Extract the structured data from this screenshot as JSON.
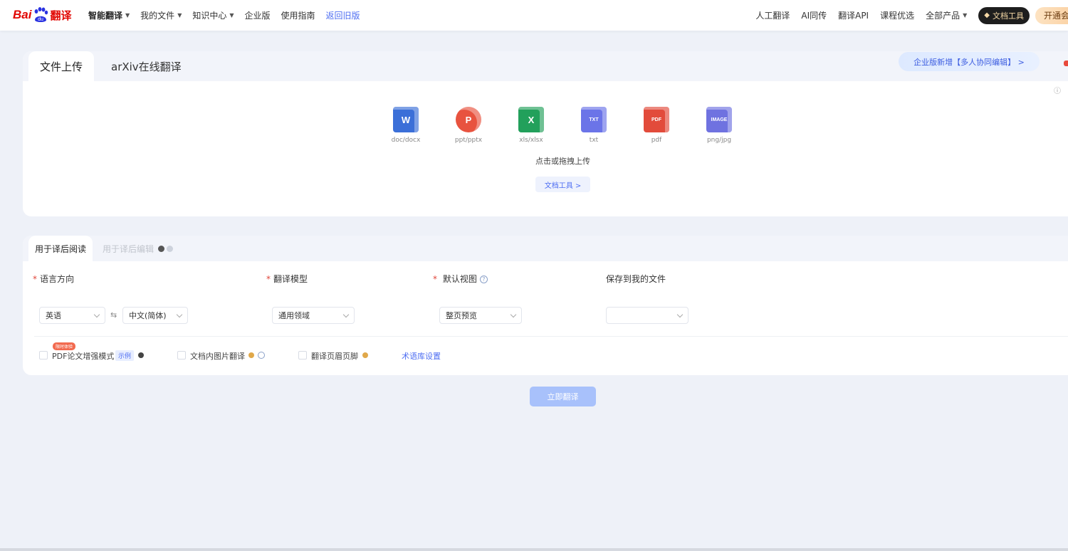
{
  "nav": {
    "logo_bai": "Bai",
    "logo_du": "du",
    "logo_fanyi": "翻译",
    "left_items": [
      {
        "label": "智能翻译",
        "caret": true,
        "bold": true
      },
      {
        "label": "我的文件",
        "caret": true
      },
      {
        "label": "知识中心",
        "caret": true
      },
      {
        "label": "企业版"
      },
      {
        "label": "使用指南"
      },
      {
        "label": "返回旧版",
        "blue": true
      }
    ],
    "right_items": [
      "人工翻译",
      "AI同传",
      "翻译API",
      "课程优选",
      "全部产品"
    ],
    "doc_tool_label": "文档工具",
    "vip_label": "开通会员"
  },
  "upload": {
    "tabs": [
      "文件上传",
      "arXiv在线翻译"
    ],
    "enterprise_banner": "企业版新增【多人协同编辑】 >",
    "file_types": [
      {
        "label": "doc/docx",
        "icon": "word-icon",
        "color": "#3b6fd8",
        "glyph": "W"
      },
      {
        "label": "ppt/pptx",
        "icon": "powerpoint-icon",
        "color": "#e8533f",
        "glyph": "P"
      },
      {
        "label": "xls/xlsx",
        "icon": "excel-icon",
        "color": "#22a05b",
        "glyph": "X"
      },
      {
        "label": "txt",
        "icon": "txt-icon",
        "color": "#6b74e8",
        "glyph": "TXT"
      },
      {
        "label": "pdf",
        "icon": "pdf-icon",
        "color": "#e24b3b",
        "glyph": "PDF"
      },
      {
        "label": "png/jpg",
        "icon": "image-icon",
        "color": "#6f72e0",
        "glyph": "IMAGE"
      }
    ],
    "hint": "点击或拖拽上传",
    "tools_button": "文档工具 >"
  },
  "settings": {
    "tabs": [
      "用于译后阅读",
      "用于译后编辑"
    ],
    "language_label": "语言方向",
    "source_lang": "英语",
    "swap_symbol": "⇆",
    "target_lang": "中文(简体)",
    "model_label": "翻译模型",
    "model_value": "通用领域",
    "view_label": "默认视图",
    "view_value": "整页预览",
    "save_label": "保存到我的文件",
    "save_value": "",
    "options": {
      "pdf_enhance": "PDF论文增强模式",
      "pdf_badge": "限时体验",
      "demo_tag": "示例",
      "image_translate": "文档内图片翻译",
      "header_footer": "翻译页眉页脚",
      "term_settings": "术语库设置"
    },
    "translate_button": "立即翻译"
  }
}
